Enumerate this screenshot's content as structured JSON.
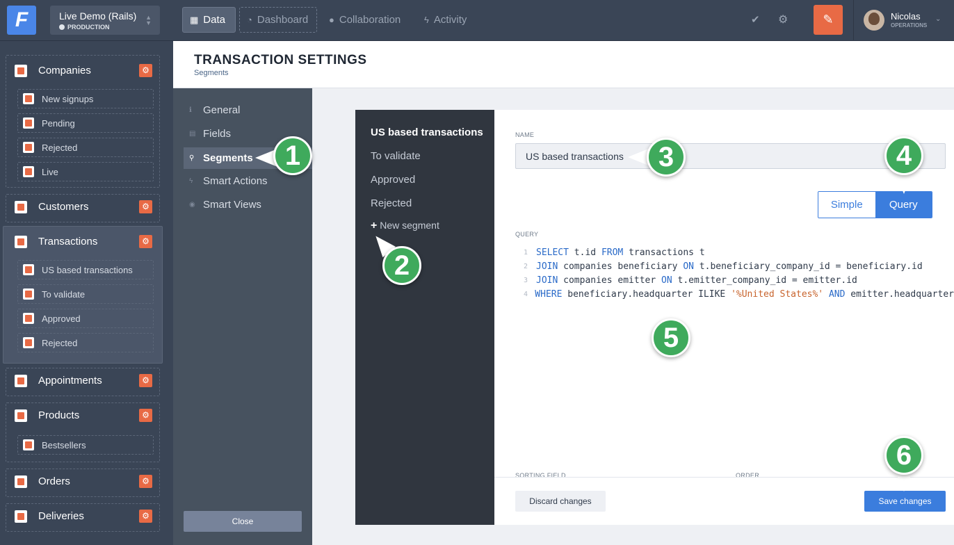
{
  "topbar": {
    "logo_letter": "F",
    "env_name": "Live Demo (Rails)",
    "env_label": "PRODUCTION",
    "nav": [
      {
        "label": "Data",
        "icon": "table-icon"
      },
      {
        "label": "Dashboard",
        "icon": "dashboard-icon"
      },
      {
        "label": "Collaboration",
        "icon": "chat-icon"
      },
      {
        "label": "Activity",
        "icon": "bolt-icon"
      }
    ],
    "user_name": "Nicolas",
    "user_role": "OPERATIONS"
  },
  "sidebar": {
    "groups": [
      {
        "label": "Companies",
        "segments": [
          "New signups",
          "Pending",
          "Rejected",
          "Live"
        ]
      },
      {
        "label": "Customers",
        "segments": []
      },
      {
        "label": "Transactions",
        "segments": [
          "US based transactions",
          "To validate",
          "Approved",
          "Rejected"
        ]
      },
      {
        "label": "Appointments",
        "segments": []
      },
      {
        "label": "Products",
        "segments": [
          "Bestsellers"
        ]
      },
      {
        "label": "Orders",
        "segments": []
      },
      {
        "label": "Deliveries",
        "segments": []
      }
    ]
  },
  "settings": {
    "title": "TRANSACTION SETTINGS",
    "subtitle": "Segments",
    "nav": [
      "General",
      "Fields",
      "Segments",
      "Smart Actions",
      "Smart Views"
    ],
    "close_label": "Close"
  },
  "segments": {
    "items": [
      "US based transactions",
      "To validate",
      "Approved",
      "Rejected"
    ],
    "new_label": "New segment"
  },
  "editor": {
    "name_label": "NAME",
    "name_value": "US based transactions",
    "toggle_simple": "Simple",
    "toggle_query": "Query",
    "query_label": "QUERY",
    "query_lines": [
      [
        {
          "t": "SELECT",
          "k": "kw"
        },
        {
          "t": " t.id ",
          "k": "txt"
        },
        {
          "t": "FROM",
          "k": "kw"
        },
        {
          "t": " transactions t",
          "k": "txt"
        }
      ],
      [
        {
          "t": "JOIN",
          "k": "kw"
        },
        {
          "t": " companies beneficiary ",
          "k": "txt"
        },
        {
          "t": "ON",
          "k": "kw"
        },
        {
          "t": " t.beneficiary_company_id = beneficiary.id",
          "k": "txt"
        }
      ],
      [
        {
          "t": "JOIN",
          "k": "kw"
        },
        {
          "t": " companies emitter ",
          "k": "txt"
        },
        {
          "t": "ON",
          "k": "kw"
        },
        {
          "t": " t.emitter_company_id = emitter.id",
          "k": "txt"
        }
      ],
      [
        {
          "t": "WHERE",
          "k": "kw"
        },
        {
          "t": " beneficiary.headquarter ILIKE ",
          "k": "txt"
        },
        {
          "t": "'%United States%'",
          "k": "str"
        },
        {
          "t": " ",
          "k": "txt"
        },
        {
          "t": "AND",
          "k": "kw"
        },
        {
          "t": " emitter.headquarter",
          "k": "txt"
        }
      ]
    ],
    "sorting_label": "SORTING FIELD",
    "order_label": "ORDER",
    "discard_label": "Discard changes",
    "save_label": "Save changes"
  },
  "badges": [
    "1",
    "2",
    "3",
    "4",
    "5",
    "6"
  ],
  "colors": {
    "accent": "#3b7ddd",
    "brand_orange": "#e86a45",
    "badge_green": "#3faa5c",
    "topbar": "#3a4556"
  }
}
